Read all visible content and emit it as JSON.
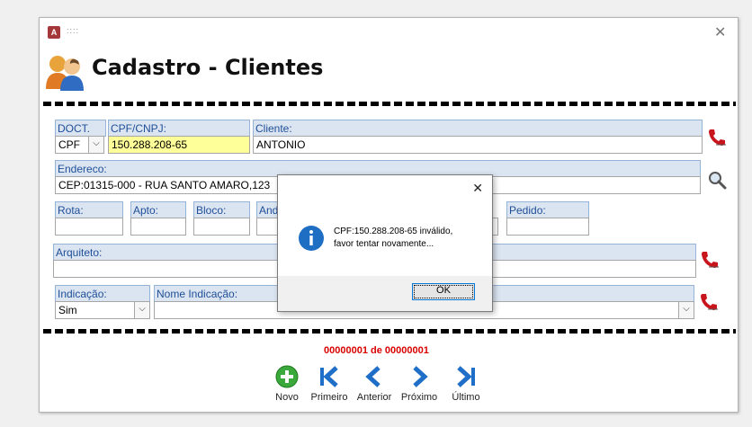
{
  "window": {
    "app_icon": "A",
    "title": "::::"
  },
  "form": {
    "title": "Cadastro - Clientes"
  },
  "fields": {
    "doct": {
      "label": "DOCT.",
      "value": "CPF"
    },
    "cpf": {
      "label": "CPF/CNPJ:",
      "value": "150.288.208-65"
    },
    "cliente": {
      "label": "Cliente:",
      "value": "ANTONIO"
    },
    "endereco": {
      "label": "Endereco:",
      "value": "CEP:01315-000 - RUA SANTO AMARO,123"
    },
    "rota": {
      "label": "Rota:",
      "value": ""
    },
    "apto": {
      "label": "Apto:",
      "value": ""
    },
    "bloco": {
      "label": "Bloco:",
      "value": ""
    },
    "andar": {
      "label": "And",
      "value": ""
    },
    "pedido": {
      "label": "Pedido:",
      "value": ""
    },
    "arquiteto": {
      "label": "Arquiteto:",
      "value": ""
    },
    "indicacao": {
      "label": "Indicação:",
      "value": "Sim"
    },
    "nome_indicacao": {
      "label": "Nome Indicação:",
      "value": ""
    }
  },
  "nav": {
    "counter": "00000001 de 00000001",
    "novo": "Novo",
    "primeiro": "Primeiro",
    "anterior": "Anterior",
    "proximo": "Próximo",
    "ultimo": "Último"
  },
  "dialog": {
    "message_line1": "CPF:150.288.208-65 inválido,",
    "message_line2": "favor tentar novamente...",
    "ok": "OK",
    "icon": "info-icon"
  },
  "colors": {
    "label_bg": "#dbe5f1",
    "label_text": "#1f4e99",
    "counter": "#d90000",
    "highlight_field": "#ffff99"
  }
}
